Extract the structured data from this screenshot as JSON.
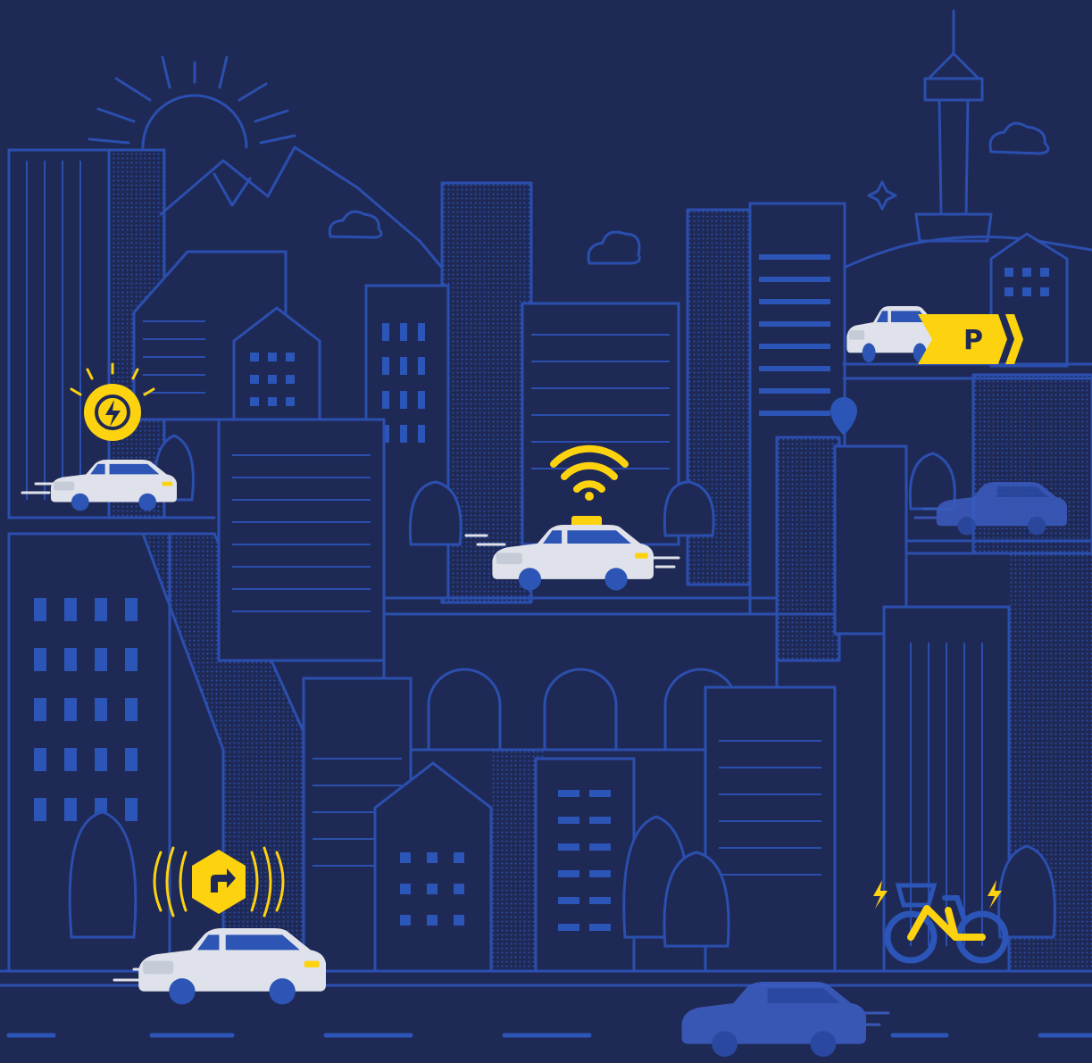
{
  "parking_sign": {
    "label": "P"
  },
  "colors": {
    "background": "#1f2955",
    "line": "#2b4fae",
    "accent": "#fdd20e",
    "car_body": "#dfe2ea",
    "car_faded": "#3b5cc0"
  },
  "icons": [
    "sun-icon",
    "cloud-icon",
    "tower-icon",
    "sparkle-icon",
    "location-pin-icon",
    "ev-charging-icon",
    "wifi-signal-icon",
    "parking-icon",
    "navigation-turn-icon",
    "lightning-icon",
    "bicycle-icon"
  ]
}
